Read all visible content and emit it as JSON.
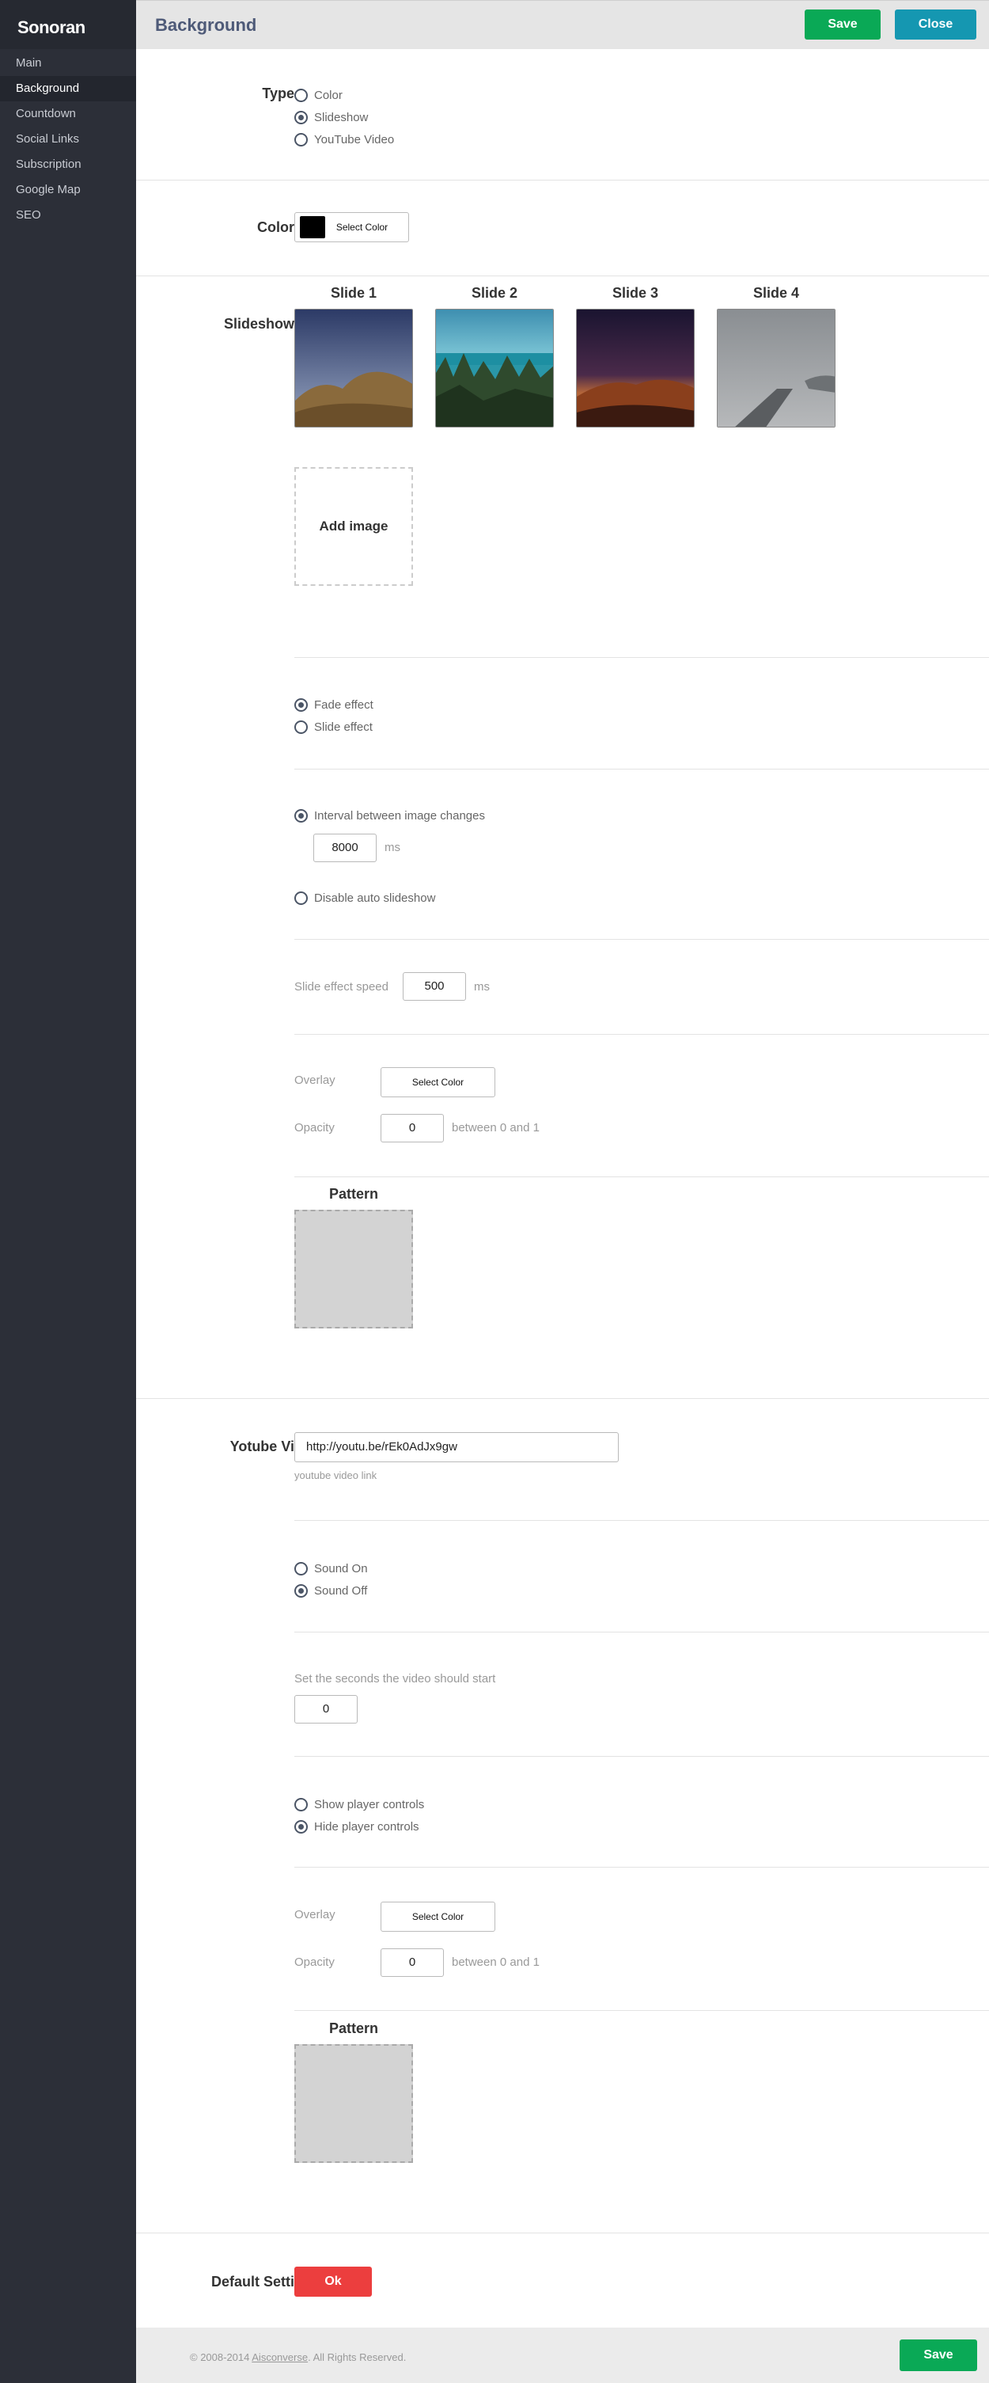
{
  "app": {
    "brand": "Sonoran"
  },
  "sidebar": {
    "items": [
      {
        "label": "Main"
      },
      {
        "label": "Background"
      },
      {
        "label": "Countdown"
      },
      {
        "label": "Social Links"
      },
      {
        "label": "Subscription"
      },
      {
        "label": "Google Map"
      },
      {
        "label": "SEO"
      }
    ],
    "active": "Background"
  },
  "header": {
    "title": "Background",
    "save_label": "Save",
    "close_label": "Close"
  },
  "type_section": {
    "label": "Type",
    "options": [
      {
        "label": "Color",
        "checked": false
      },
      {
        "label": "Slideshow",
        "checked": true
      },
      {
        "label": "YouTube Video",
        "checked": false
      }
    ]
  },
  "color_section": {
    "label": "Color",
    "button_label": "Select Color",
    "swatch_color": "#000000"
  },
  "slideshow": {
    "label": "Slideshow",
    "slides": [
      {
        "title": "Slide 1"
      },
      {
        "title": "Slide 2"
      },
      {
        "title": "Slide 3"
      },
      {
        "title": "Slide 4"
      }
    ],
    "add_image_label": "Add image",
    "effects": [
      {
        "label": "Fade effect",
        "checked": true
      },
      {
        "label": "Slide effect",
        "checked": false
      }
    ],
    "interval": {
      "label": "Interval between image changes",
      "checked": true,
      "value": "8000",
      "unit": "ms"
    },
    "disable_auto": {
      "label": "Disable auto slideshow",
      "checked": false
    },
    "speed": {
      "label": "Slide effect speed",
      "value": "500",
      "unit": "ms"
    },
    "overlay": {
      "label": "Overlay",
      "button_label": "Select Color"
    },
    "opacity": {
      "label": "Opacity",
      "value": "0",
      "hint": "between 0 and 1"
    },
    "pattern": {
      "title": "Pattern"
    }
  },
  "youtube": {
    "label": "Yotube Video",
    "url_value": "http://youtu.be/rEk0AdJx9gw",
    "url_hint": "youtube video link",
    "sound": [
      {
        "label": "Sound On",
        "checked": false
      },
      {
        "label": "Sound Off",
        "checked": true
      }
    ],
    "start": {
      "label": "Set the seconds the video should start",
      "value": "0"
    },
    "controls": [
      {
        "label": "Show player controls",
        "checked": false
      },
      {
        "label": "Hide player controls",
        "checked": true
      }
    ],
    "overlay": {
      "label": "Overlay",
      "button_label": "Select Color"
    },
    "opacity": {
      "label": "Opacity",
      "value": "0",
      "hint": "between 0 and 1"
    },
    "pattern": {
      "title": "Pattern"
    }
  },
  "defaults": {
    "label": "Default Settings",
    "ok_label": "Ok"
  },
  "footer": {
    "copyright_prefix": "© 2008-2014 ",
    "company": "Aisconverse",
    "copyright_suffix": ". All Rights Reserved.",
    "save_label": "Save"
  },
  "colors": {
    "save": "#0aa956",
    "close": "#1597b1",
    "ok": "#ec3e3e",
    "sidebar": "#2c2f38",
    "title": "#4e5a78"
  }
}
